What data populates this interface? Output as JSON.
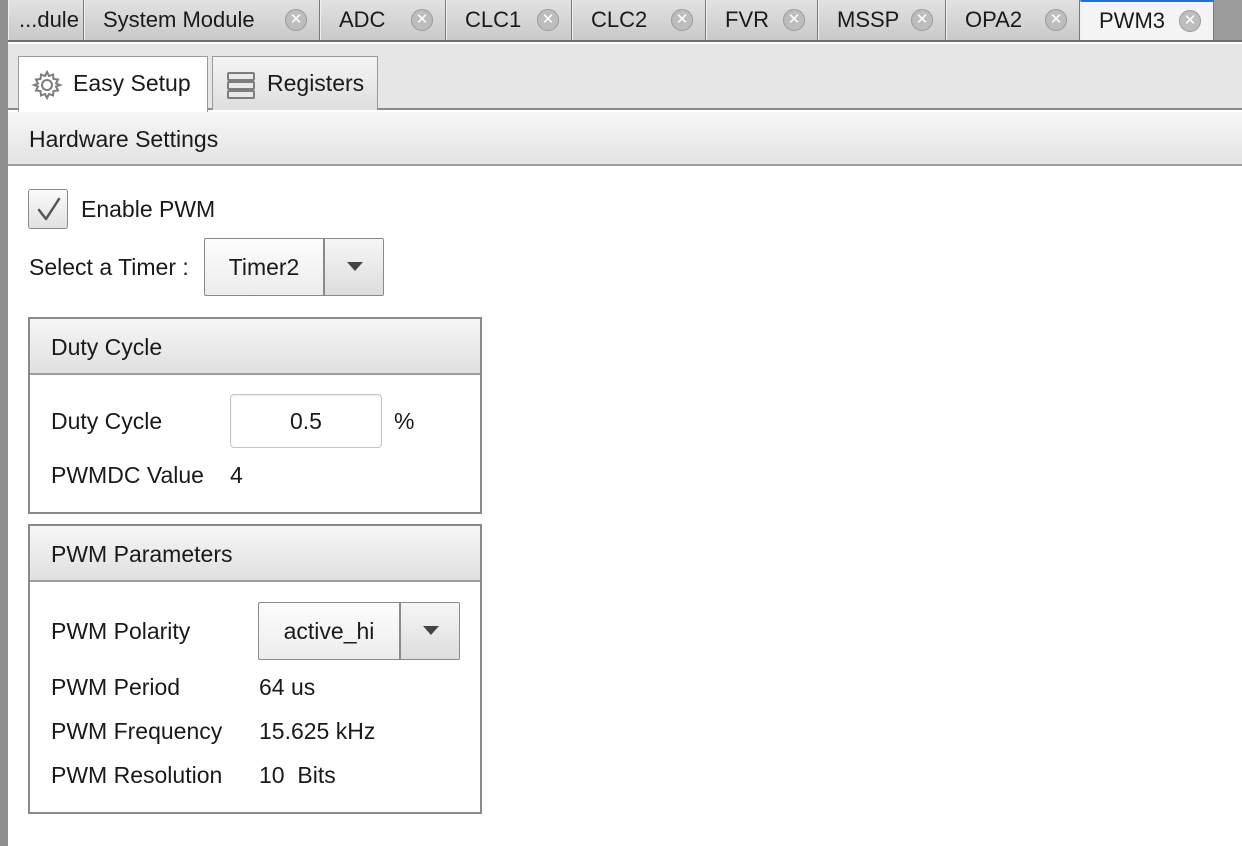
{
  "doc_tabs": [
    {
      "label": "...dule"
    },
    {
      "label": "System Module"
    },
    {
      "label": "ADC"
    },
    {
      "label": "CLC1"
    },
    {
      "label": "CLC2"
    },
    {
      "label": "FVR"
    },
    {
      "label": "MSSP"
    },
    {
      "label": "OPA2"
    },
    {
      "label": "PWM3",
      "active": true
    }
  ],
  "view_tabs": [
    {
      "label": "Easy Setup",
      "icon": "gear-icon",
      "active": true
    },
    {
      "label": "Registers",
      "icon": "registers-icon"
    }
  ],
  "hardware": {
    "header": "Hardware Settings",
    "enable_label": "Enable PWM",
    "enable_checked": true,
    "timer_label": "Select a Timer :",
    "timer_value": "Timer2"
  },
  "duty_cycle": {
    "header": "Duty Cycle",
    "label": "Duty Cycle",
    "value": "0.5",
    "unit": "%",
    "pwmdc_label": "PWMDC Value",
    "pwmdc_value": "4"
  },
  "pwm_params": {
    "header": "PWM Parameters",
    "polarity_label": "PWM Polarity",
    "polarity_value": "active_hi",
    "period_label": "PWM Period",
    "period_value": "64 us",
    "frequency_label": "PWM Frequency",
    "frequency_value": "15.625 kHz",
    "resolution_label": "PWM Resolution",
    "resolution_value": "10  Bits"
  },
  "colors": {
    "active_tab_accent": "#2b6fd6",
    "panel_border": "#8a8a8a"
  }
}
